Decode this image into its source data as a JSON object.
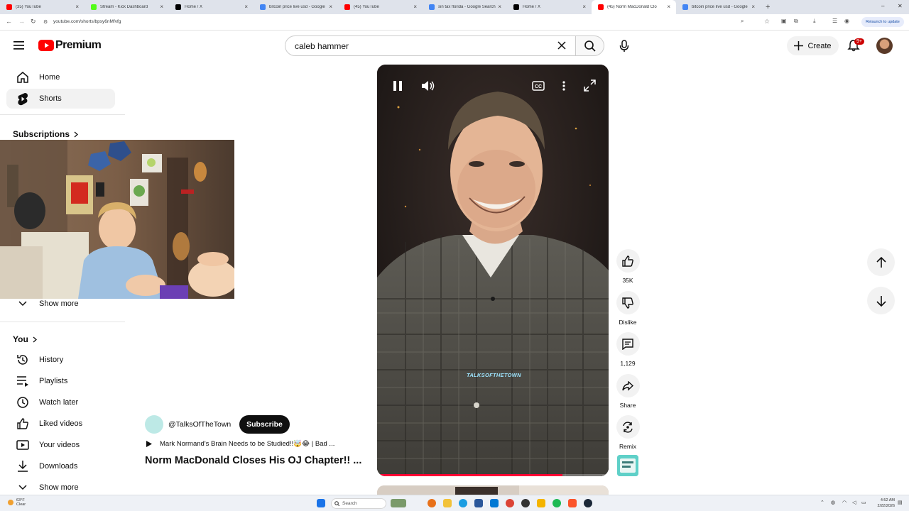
{
  "browser": {
    "tabs": [
      {
        "title": "(35) YouTube",
        "color": "#ff0000"
      },
      {
        "title": "Stream - Kick Dashboard",
        "color": "#53fc18"
      },
      {
        "title": "Home / X",
        "color": "#000000"
      },
      {
        "title": "bitcoin price live usd - Google",
        "color": "#4285f4"
      },
      {
        "title": "(45) YouTube",
        "color": "#ff0000"
      },
      {
        "title": "sin tax florida - Google Search",
        "color": "#4285f4"
      },
      {
        "title": "Home / X",
        "color": "#000000"
      },
      {
        "title": "(45) Norm MacDonald Clo",
        "color": "#ff0000"
      },
      {
        "title": "bitcoin price live usd - Google",
        "color": "#4285f4"
      }
    ],
    "url": "youtube.com/shorts/bpsy6nMfvfg",
    "relaunch_label": "Relaunch to update"
  },
  "header": {
    "logo": "Premium",
    "search_value": "caleb hammer",
    "create_label": "Create",
    "notif_badge": "9+"
  },
  "sidebar": {
    "top": [
      {
        "label": "Home",
        "icon": "home-icon"
      },
      {
        "label": "Shorts",
        "icon": "shorts-icon"
      }
    ],
    "subscriptions_title": "Subscriptions",
    "show_more_1": "Show more",
    "you_title": "You",
    "you_items": [
      {
        "label": "History",
        "icon": "history-icon"
      },
      {
        "label": "Playlists",
        "icon": "playlists-icon"
      },
      {
        "label": "Watch later",
        "icon": "watch-later-icon"
      },
      {
        "label": "Liked videos",
        "icon": "like-icon"
      },
      {
        "label": "Your videos",
        "icon": "your-videos-icon"
      },
      {
        "label": "Downloads",
        "icon": "download-icon"
      }
    ],
    "show_more_2": "Show more"
  },
  "short": {
    "watermark": "TALKSOFTHETOWN",
    "progress": 0.8,
    "channel": "@TalksOfTheTown",
    "subscribe_label": "Subscribe",
    "playlist_text": "Mark Normand's Brain Needs to be Studied!!🤯😂 | Bad ...",
    "title": "Norm MacDonald Closes His OJ Chapter!! ..."
  },
  "actions": {
    "like_count": "35K",
    "dislike_label": "Dislike",
    "comments_count": "1,129",
    "share_label": "Share",
    "remix_label": "Remix"
  },
  "taskbar": {
    "weather_temp": "63°F",
    "weather_desc": "Clear",
    "search_label": "Search",
    "time": "4:52 AM",
    "date": "2/22/2026"
  }
}
